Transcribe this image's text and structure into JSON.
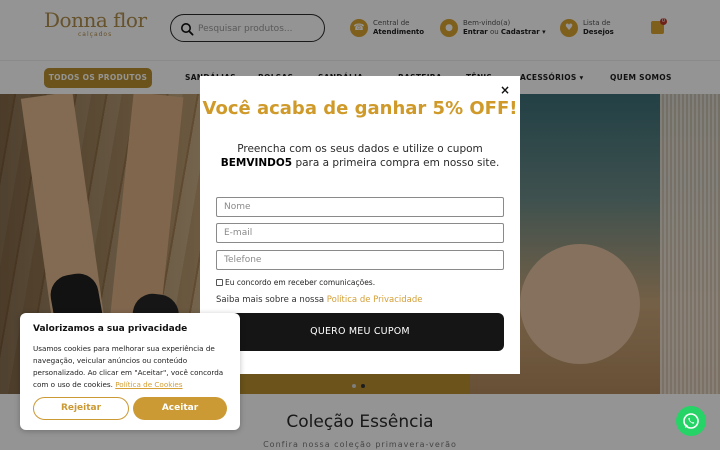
{
  "header": {
    "logo_main": "Donna flor",
    "logo_sub": "calçados",
    "search_placeholder": "Pesquisar produtos...",
    "service_line1": "Central de",
    "service_line2": "Atendimento",
    "account_line1": "Bem-vindo(a)",
    "account_login": "Entrar",
    "account_or": " ou ",
    "account_register": "Cadastrar",
    "account_chevron": " ▾",
    "wishlist_line1": "Lista de",
    "wishlist_line2": "Desejos",
    "cart_count": "0"
  },
  "nav": {
    "all_products": "TODOS OS PRODUTOS",
    "items": [
      "SANDÁLIAS",
      "BOLSAS",
      "SANDÁLIA",
      "RASTEIRA",
      "TÊNIS",
      "ACESSÓRIOS",
      "QUEM SOMOS"
    ]
  },
  "section": {
    "title": "Coleção Essência",
    "subtitle": "Confira nossa coleção primavera-verão"
  },
  "popup": {
    "close": "×",
    "title": "Você acaba de ganhar 5% OFF!",
    "desc_before": "Preencha com os seus dados e utilize o cupom ",
    "coupon": "BEMVINDO5",
    "desc_after": " para a primeira compra em nosso site.",
    "name_placeholder": "Nome",
    "email_placeholder": "E-mail",
    "phone_placeholder": "Telefone",
    "consent_label": "Eu concordo em receber comunicações.",
    "privacy_text": "Saiba mais sobre a nossa ",
    "privacy_link": "Política de Privacidade",
    "cta": "QUERO MEU CUPOM"
  },
  "cookie": {
    "title": "Valorizamos a sua privacidade",
    "body": "Usamos cookies para melhorar sua experiência de navegação, veicular anúncios ou conteúdo personalizado. Ao clicar em \"Aceitar\", você concorda com o uso de cookies. ",
    "policy_link": "Política de Cookies",
    "reject": "Rejeitar",
    "accept": "Aceitar"
  },
  "colors": {
    "brand_gold": "#b8902f",
    "popup_title": "#cf9a2a",
    "whatsapp": "#25d366"
  }
}
